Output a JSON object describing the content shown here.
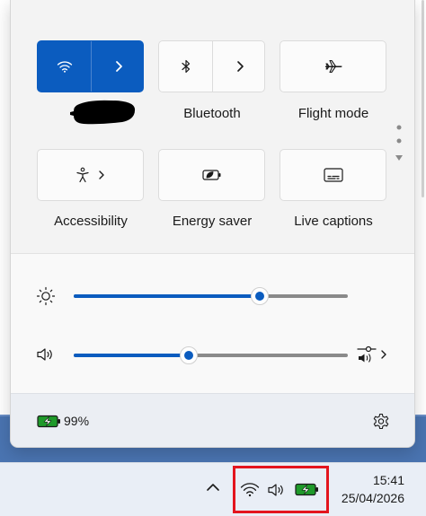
{
  "quick_settings": {
    "tiles": [
      {
        "name": "wifi",
        "label": "",
        "active": true
      },
      {
        "name": "bluetooth",
        "label": "Bluetooth",
        "active": false
      },
      {
        "name": "flight-mode",
        "label": "Flight mode",
        "active": false
      },
      {
        "name": "accessibility",
        "label": "Accessibility",
        "active": false
      },
      {
        "name": "energy-saver",
        "label": "Energy saver",
        "active": false
      },
      {
        "name": "live-captions",
        "label": "Live captions",
        "active": false
      }
    ],
    "brightness_level": 0.68,
    "volume_level": 0.42,
    "battery_text": "99%"
  },
  "taskbar": {
    "time": "15:41",
    "date": "25/04/2026"
  },
  "colors": {
    "accent": "#0b5cbf",
    "battery": "#1f9a2a",
    "highlight_box": "#e3151e"
  }
}
